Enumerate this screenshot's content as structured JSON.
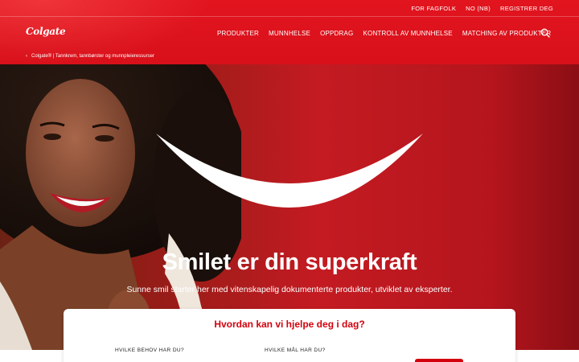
{
  "header": {
    "utility_links": [
      "FOR FAGFOLK",
      "NO (NB)",
      "REGISTRER DEG"
    ],
    "logo": "Colgate",
    "nav": [
      "PRODUKTER",
      "MUNNHELSE",
      "OPPDRAG",
      "KONTROLL AV MUNNHELSE",
      "MATCHING AV PRODUKTER"
    ],
    "search_icon": "search-icon"
  },
  "breadcrumb": {
    "chevron": "‹",
    "text": "Colgate® | Tannkrem, tannbørster og munnpleieressurser"
  },
  "hero": {
    "title": "Smilet er din superkraft",
    "subtitle": "Sunne smil starter her med vitenskapelig dokumenterte produkter, utviklet av eksperter."
  },
  "help_card": {
    "title": "Hvordan kan vi hjelpe deg i dag?",
    "question_need": "HVILKE BEHOV HAR DU?",
    "question_goal": "HVILKE MÅL HAR DU?"
  },
  "colors": {
    "brand_red": "#d2010d",
    "hero_red": "#c41b22"
  }
}
